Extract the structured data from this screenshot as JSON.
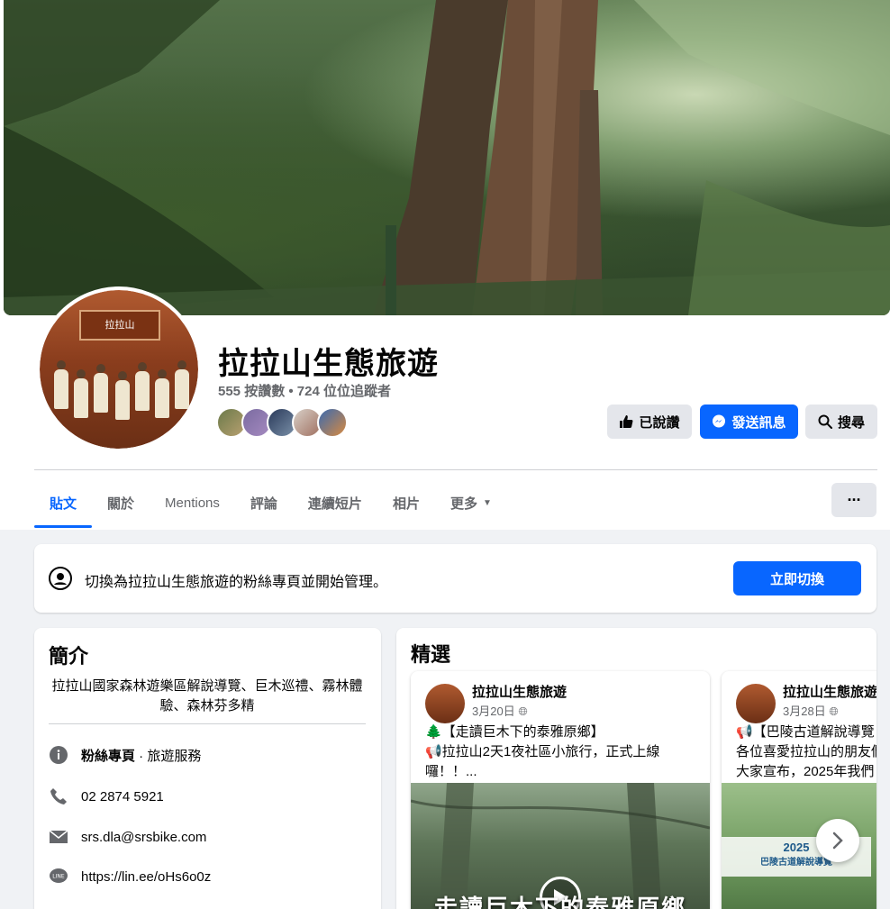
{
  "page": {
    "name": "拉拉山生態旅遊",
    "stats": "555 按讚數 • 724 位位追蹤者",
    "avatar_sign": "拉拉山"
  },
  "actions": {
    "liked_label": "已說讚",
    "message_label": "發送訊息",
    "search_label": "搜尋"
  },
  "tabs": [
    {
      "label": "貼文"
    },
    {
      "label": "關於"
    },
    {
      "label": "Mentions"
    },
    {
      "label": "評論"
    },
    {
      "label": "連續短片"
    },
    {
      "label": "相片"
    },
    {
      "label": "更多"
    }
  ],
  "more_menu_label": "···",
  "switch_banner": {
    "text": "切換為拉拉山生態旅遊的粉絲專頁並開始管理。",
    "button_label": "立即切換"
  },
  "intro": {
    "title": "簡介",
    "bio": "拉拉山國家森林遊樂區解說導覽、巨木巡禮、霧林體驗、森林芬多精",
    "category_bold": "粉絲專頁",
    "category_rest": " · 旅遊服務",
    "phone": "02 2874 5921",
    "email": "srs.dla@srsbike.com",
    "line": "https://lin.ee/oHs6o0z"
  },
  "featured": {
    "title": "精選",
    "posts": [
      {
        "author": "拉拉山生態旅遊",
        "date": "3月20日",
        "line1": "🌲【走讀巨木下的泰雅原鄉】",
        "line2": "📢拉拉山2天1夜社區小旅行，正式上線",
        "line3": "囉！！...",
        "overlay": "走讀巨木下的泰雅原鄉"
      },
      {
        "author": "拉拉山生態旅遊",
        "date": "3月28日",
        "line1": "📢【巴陵古道解說導覽",
        "line2": "各位喜愛拉拉山的朋友們",
        "line3": "大家宣布，2025年我們",
        "banner_year": "2025",
        "banner_text": "巴陵古道解說導覽"
      }
    ]
  }
}
